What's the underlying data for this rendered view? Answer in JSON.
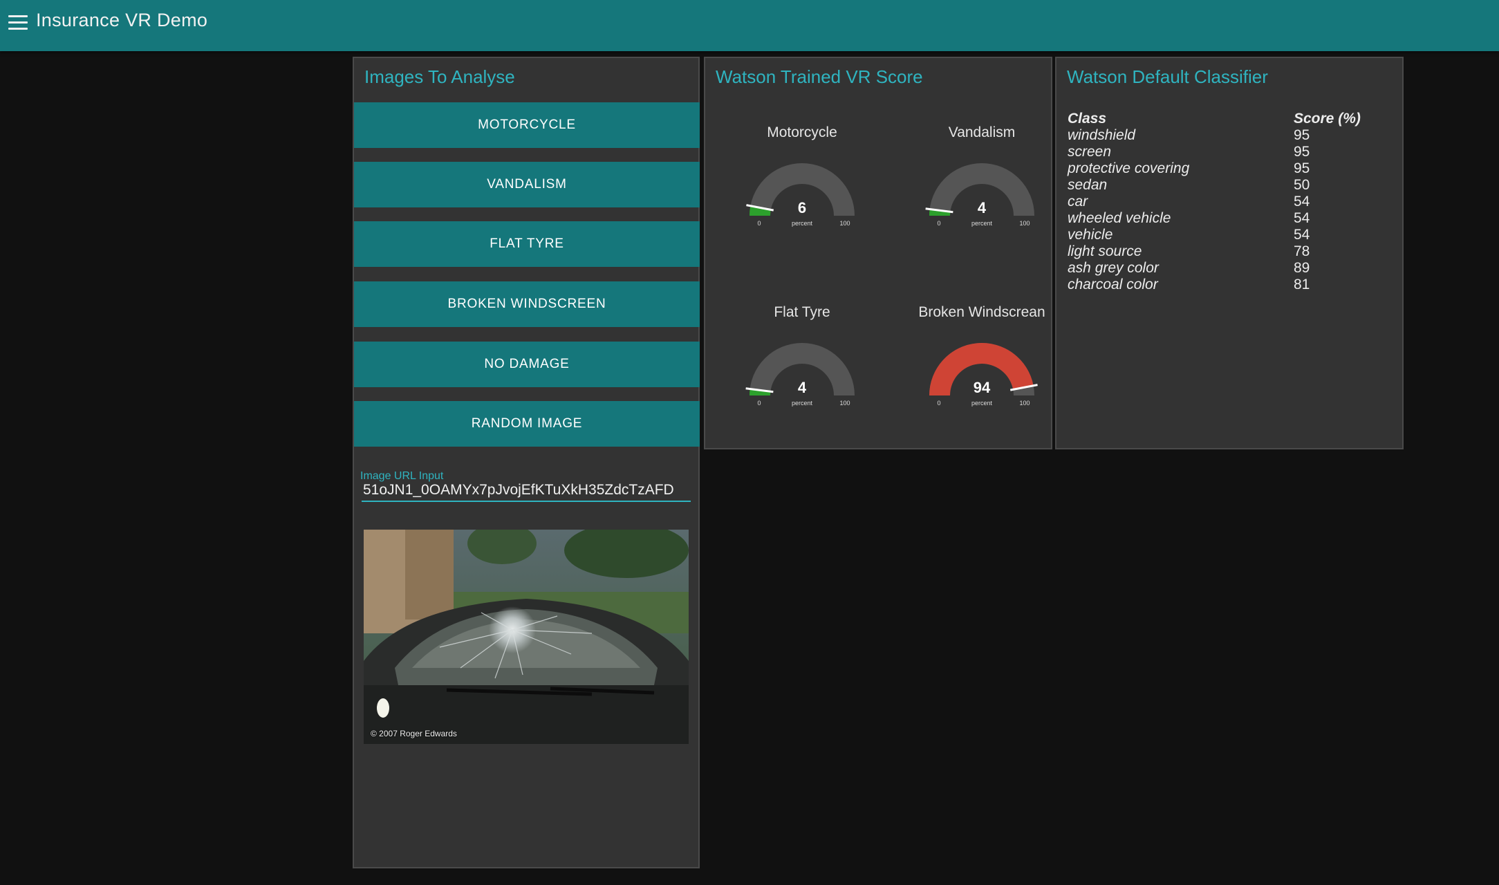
{
  "app": {
    "title": "Insurance VR Demo"
  },
  "images_panel": {
    "title": "Images To Analyse",
    "buttons": [
      "MOTORCYCLE",
      "VANDALISM",
      "FLAT TYRE",
      "BROKEN WINDSCREEN",
      "NO DAMAGE",
      "RANDOM IMAGE"
    ],
    "url_input": {
      "label": "Image URL Input",
      "value": "51oJN1_0OAMYx7pJvojEfKTuXkH35ZdcTzAFD"
    },
    "image_credit": "© 2007 Roger Edwards"
  },
  "watson_panel": {
    "title": "Watson Trained VR Score",
    "gauges": [
      {
        "label": "Motorcycle",
        "value": 6,
        "unit": "percent",
        "min": "0",
        "max": "100",
        "color": "#2ca02c"
      },
      {
        "label": "Vandalism",
        "value": 4,
        "unit": "percent",
        "min": "0",
        "max": "100",
        "color": "#2ca02c"
      },
      {
        "label": "Flat Tyre",
        "value": 4,
        "unit": "percent",
        "min": "0",
        "max": "100",
        "color": "#2ca02c"
      },
      {
        "label": "Broken Windscrean",
        "value": 94,
        "unit": "percent",
        "min": "0",
        "max": "100",
        "color": "#cf4435"
      }
    ]
  },
  "default_panel": {
    "title": "Watson Default Classifier",
    "headers": {
      "class": "Class",
      "score": "Score (%)"
    },
    "rows": [
      {
        "class": "windshield",
        "score": "95"
      },
      {
        "class": "screen",
        "score": "95"
      },
      {
        "class": "protective covering",
        "score": "95"
      },
      {
        "class": "sedan",
        "score": "50"
      },
      {
        "class": "car",
        "score": "54"
      },
      {
        "class": "wheeled vehicle",
        "score": "54"
      },
      {
        "class": "vehicle",
        "score": "54"
      },
      {
        "class": "light source",
        "score": "78"
      },
      {
        "class": "ash grey color",
        "score": "89"
      },
      {
        "class": "charcoal color",
        "score": "81"
      }
    ]
  },
  "colors": {
    "accent": "#15777b",
    "title": "#2fb4c0",
    "gauge_track": "#555555"
  }
}
